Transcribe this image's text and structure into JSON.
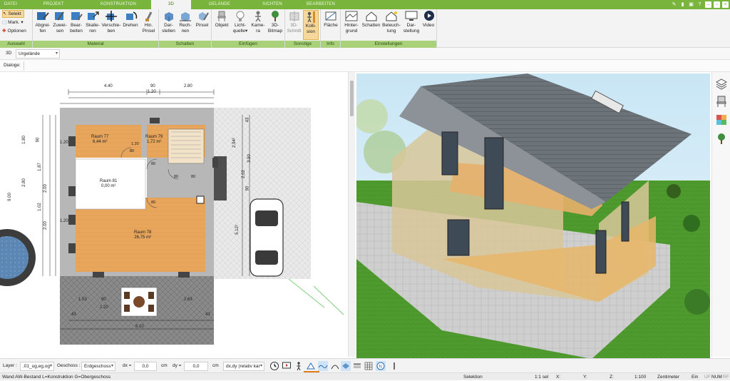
{
  "tabs": [
    {
      "label": "DATEI",
      "active": false
    },
    {
      "label": "PROJEKT",
      "active": false
    },
    {
      "label": "KONSTRUKTION",
      "active": false
    },
    {
      "label": "3D",
      "active": true
    },
    {
      "label": "GELÄNDE",
      "active": false
    },
    {
      "label": "SICHTEN",
      "active": false
    },
    {
      "label": "BEARBEITEN",
      "active": false
    }
  ],
  "ribbon": {
    "auswahl": {
      "title": "Auswahl",
      "selekt": "Selekt",
      "mark": "Mark.",
      "optionen": "Optionen"
    },
    "material": {
      "title": "Material",
      "buttons": [
        {
          "line1": "Abgrei-",
          "line2": "fen"
        },
        {
          "line1": "Zuwei-",
          "line2": "sen"
        },
        {
          "line1": "Bear-",
          "line2": "beiten"
        },
        {
          "line1": "Skalie-",
          "line2": "ren"
        },
        {
          "line1": "Verschie-",
          "line2": "ben"
        },
        {
          "line1": "Drehen",
          "line2": ""
        },
        {
          "line1": "Hin.",
          "line2": "Pinsel"
        }
      ]
    },
    "schatten": {
      "title": "Schatten",
      "buttons": [
        {
          "line1": "Dar-",
          "line2": "stellen"
        },
        {
          "line1": "Rech-",
          "line2": "nen"
        },
        {
          "line1": "Pinsel",
          "line2": ""
        }
      ]
    },
    "einfuegen": {
      "title": "Einfügen",
      "buttons": [
        {
          "line1": "Objekt",
          "line2": ""
        },
        {
          "line1": "Licht-",
          "line2": "quelle"
        },
        {
          "line1": "Kame-",
          "line2": "ra"
        },
        {
          "line1": "3D-",
          "line2": "Bitmap"
        }
      ]
    },
    "sonstige": {
      "title": "Sonstige",
      "buttons": [
        {
          "line1": "3D-",
          "line2": "Schnitt"
        },
        {
          "line1": "Kolli-",
          "line2": "sion"
        }
      ]
    },
    "info": {
      "title": "Info",
      "buttons": [
        {
          "line1": "Fläche",
          "line2": ""
        }
      ]
    },
    "einstellungen": {
      "title": "Einstellungen",
      "buttons": [
        {
          "line1": "Hinter-",
          "line2": "grund"
        },
        {
          "line1": "Schatten",
          "line2": ""
        },
        {
          "line1": "Beleuch-",
          "line2": "tung"
        },
        {
          "line1": "Dar-",
          "line2": "stellung"
        },
        {
          "line1": "Video",
          "line2": ""
        }
      ]
    }
  },
  "view_row": {
    "label": "3D",
    "value": "Urgelände"
  },
  "dialog_row": {
    "label": "Dialoge:"
  },
  "plan": {
    "rooms": [
      {
        "name": "Raum 77",
        "area": "6,44 m²"
      },
      {
        "name": "Raum 79",
        "area": "1,72 m²"
      },
      {
        "name": "Raum 81",
        "area": "0,00 m²"
      },
      {
        "name": "Raum 78",
        "area": "26,75 m²"
      }
    ],
    "dims_top": [
      "4.40",
      "90",
      "1.20",
      "2.80"
    ],
    "dims_left": [
      "1.80",
      "90",
      "1.87",
      "2.80",
      "2.00",
      "1.02",
      "2.00",
      "9.00",
      "1.20",
      "1.20"
    ],
    "dims_right": [
      "2.94²",
      "3.90",
      "2.02",
      "5.12²",
      "90",
      "43"
    ],
    "dims_bottom": [
      "1.53",
      "90",
      "1.20",
      "2.63",
      "43",
      "43",
      "6.10"
    ],
    "small_dims": [
      "80",
      "80",
      "80",
      "80",
      "80",
      "1.20"
    ]
  },
  "bottom": {
    "layer_label": "Layer :",
    "layer_value": ".01_ug,eg,og",
    "geschoss_label": "Geschoss :",
    "geschoss_value": "Erdgeschoss",
    "dx_label": "dx =",
    "dx_value": "0,0",
    "dx_unit": "cm",
    "dy_label": "dy =",
    "dy_value": "0,0",
    "dy_unit": "cm",
    "mode_value": "dx,dy (relativ kar"
  },
  "status": {
    "left": "Wand AW-Bestand L=Konstruktion G=Obergeschoss",
    "mode": "Selektion",
    "sel": "1:1 sel",
    "x": "X:",
    "y": "Y:",
    "z": "Z:",
    "scale": "1:100",
    "unit": "Zentimeter",
    "ein": "Ein",
    "uf": "UF",
    "num": "NUM",
    "rf": "RF"
  },
  "colors": {
    "accent": "#79b43c",
    "ribbon_group": "#a8d17a",
    "room_floor": "#e6a45c",
    "wall": "#a9a9a9"
  }
}
